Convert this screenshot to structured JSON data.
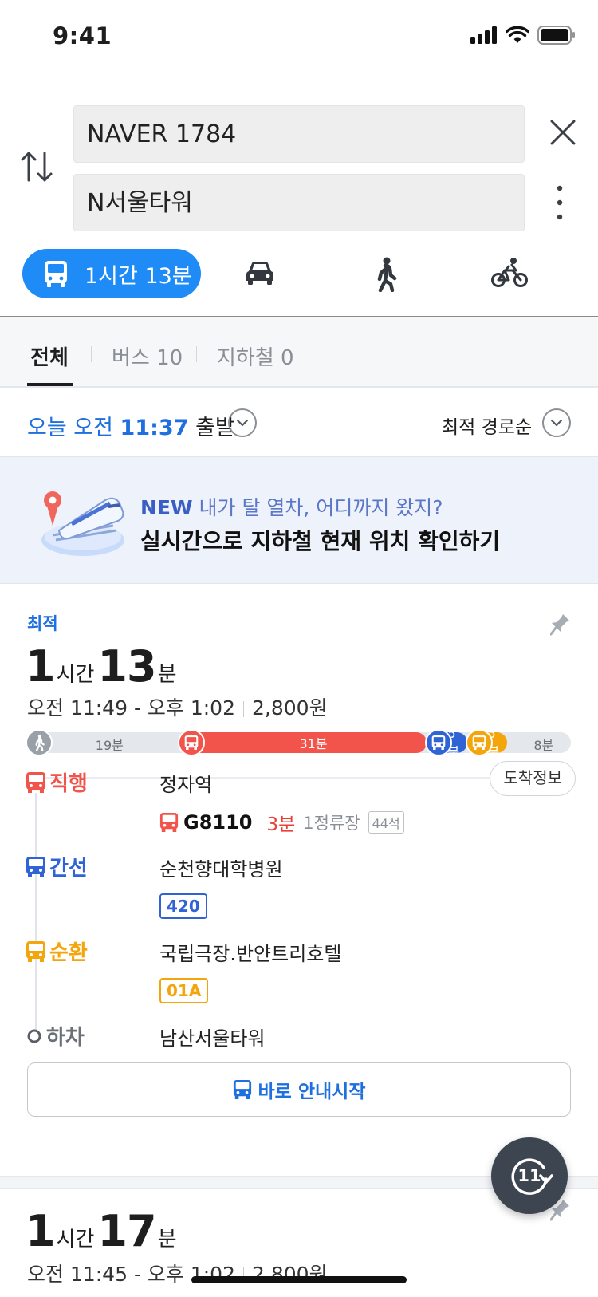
{
  "status_bar": {
    "time": "9:41"
  },
  "search": {
    "origin": "NAVER 1784",
    "destination": "N서울타워"
  },
  "mode_tabs": {
    "active_label": "1시간 13분"
  },
  "filter_tabs": {
    "all": "전체",
    "bus": "버스 10",
    "subway": "지하철 0"
  },
  "departure": {
    "prefix": "오늘 오전 ",
    "time": "11:37",
    "suffix": " 출발",
    "sort": "최적 경로순"
  },
  "banner": {
    "new_tag": "NEW",
    "line1_rest": " 내가 탈 열차, 어디까지 왔지?",
    "line2": "실시간으로 지하철 현재 위치 확인하기"
  },
  "route1": {
    "tag": "최적",
    "hours": "1",
    "hours_unit": "시간",
    "minutes": "13",
    "minutes_unit": "분",
    "time_range": "오전 11:49 - 오후 1:02",
    "fare": "2,800원",
    "segments": [
      {
        "kind": "walk",
        "label": "19분",
        "start": 0,
        "end": 19
      },
      {
        "kind": "express",
        "label": "31분",
        "start": 19,
        "end": 50
      },
      {
        "kind": "trunk",
        "label": "5분",
        "start": 50,
        "end": 55
      },
      {
        "kind": "circular",
        "label": "5분",
        "start": 55,
        "end": 60
      },
      {
        "kind": "walk",
        "label": "8분",
        "start": 60,
        "end": 68
      }
    ],
    "legs": {
      "express": {
        "type": "직행",
        "stop": "정자역",
        "arrival_btn": "도착정보",
        "bus": "G8110",
        "wait": "3분",
        "stops": "1정류장",
        "seats": "44석"
      },
      "trunk": {
        "type": "간선",
        "stop": "순천향대학병원",
        "bus": "420"
      },
      "circular": {
        "type": "순환",
        "stop": "국립극장.반얀트리호텔",
        "bus": "01A"
      },
      "alight": {
        "type": "하차",
        "stop": "남산서울타워"
      }
    },
    "start_btn": "바로 안내시작"
  },
  "route2": {
    "hours": "1",
    "hours_unit": "시간",
    "minutes": "17",
    "minutes_unit": "분",
    "time_range": "오전 11:45 - 오후 1:02",
    "fare": "2,800원"
  },
  "refresh": {
    "label": "11"
  },
  "colors": {
    "accent": "#1e8bf7",
    "express": "#f2544b",
    "trunk": "#2f63d6",
    "circular": "#f5a50c",
    "walk": "#9aa0a8"
  }
}
